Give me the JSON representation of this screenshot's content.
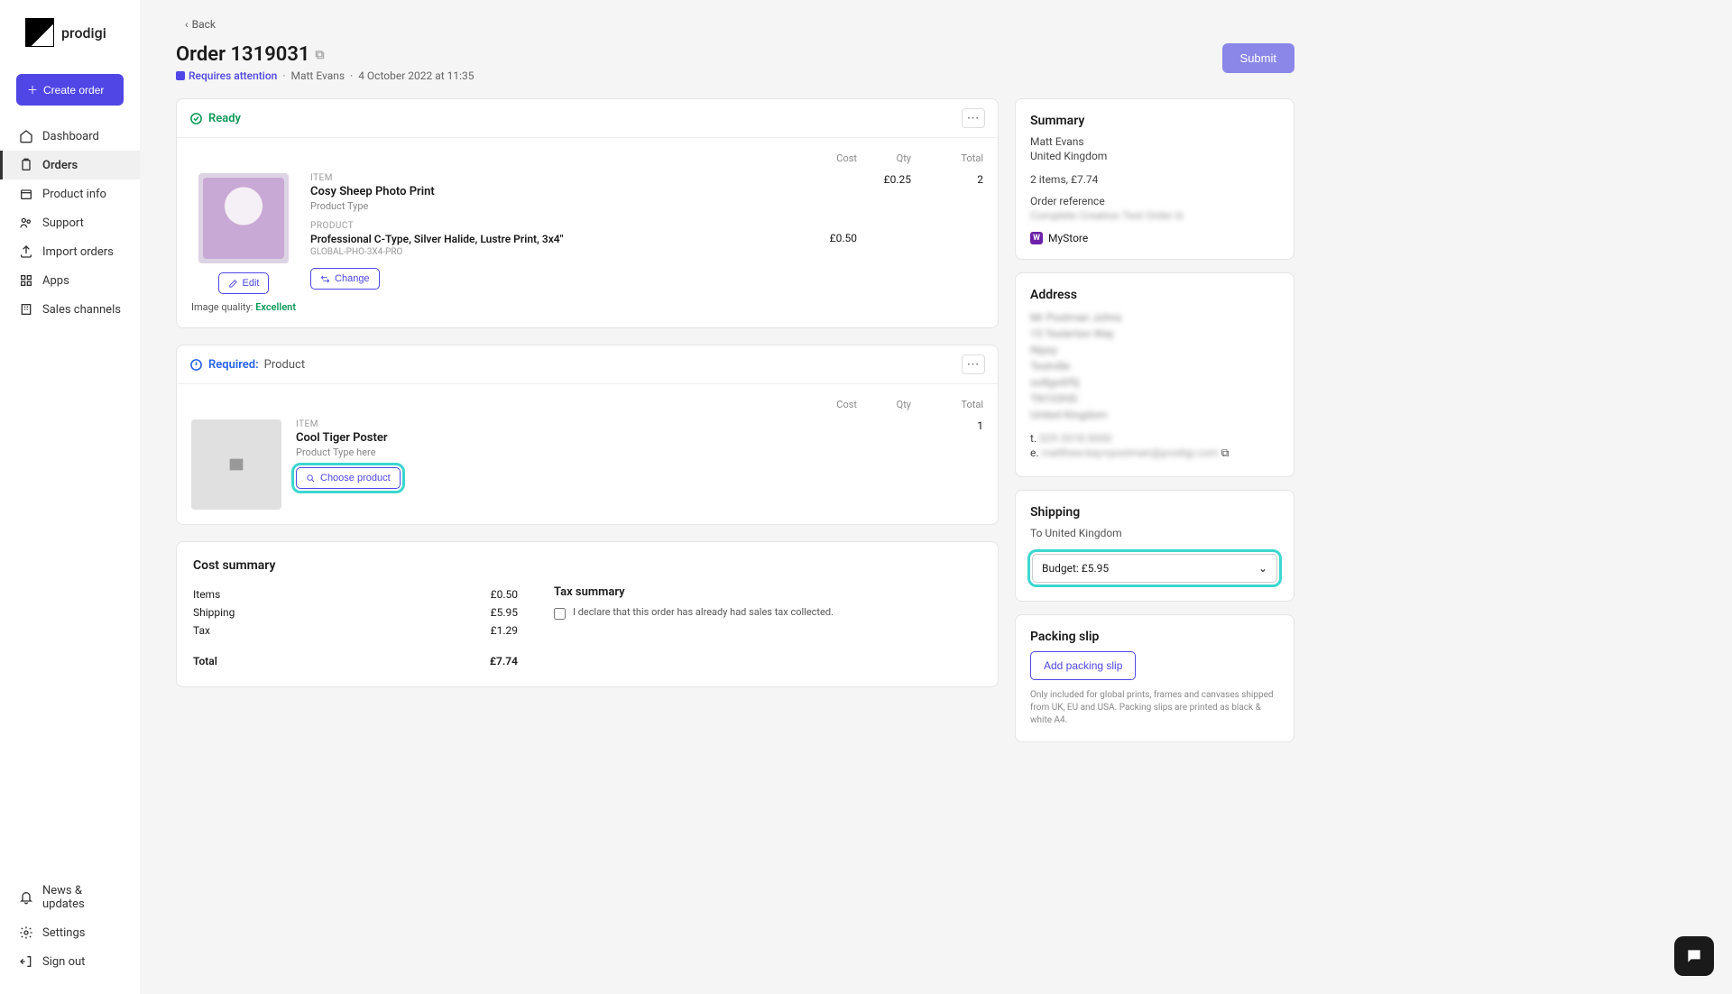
{
  "brand": {
    "name": "prodigi"
  },
  "sidebar": {
    "create_label": "Create order",
    "items": [
      {
        "label": "Dashboard"
      },
      {
        "label": "Orders"
      },
      {
        "label": "Product info"
      },
      {
        "label": "Support"
      },
      {
        "label": "Import orders"
      },
      {
        "label": "Apps"
      },
      {
        "label": "Sales channels"
      }
    ],
    "bottom": [
      {
        "label": "News & updates"
      },
      {
        "label": "Settings"
      },
      {
        "label": "Sign out"
      }
    ]
  },
  "back_label": "Back",
  "page_title": "Order 1319031",
  "status_requires": "Requires attention",
  "customer": "Matt Evans",
  "timestamp": "4 October 2022 at 11:35",
  "submit_label": "Submit",
  "line_cols": {
    "cost": "Cost",
    "qty": "Qty",
    "total": "Total"
  },
  "ready_label": "Ready",
  "item1": {
    "section_label": "ITEM",
    "name": "Cosy Sheep Photo Print",
    "type_label": "Product Type",
    "product_section_label": "PRODUCT",
    "product_line": "Professional C-Type, Silver Halide, Lustre Print, 3x4\"",
    "sku": "GLOBAL-PHO-3X4-PRO",
    "cost": "£0.25",
    "qty": "2",
    "total": "£0.50",
    "edit": "Edit",
    "change": "Change",
    "iq_label": "Image quality:",
    "iq_val": "Excellent"
  },
  "required_prefix": "Required:",
  "required_suffix": "Product",
  "item2": {
    "section_label": "ITEM",
    "name": "Cool Tiger Poster",
    "type_label": "Product Type here",
    "qty": "1",
    "choose": "Choose product"
  },
  "summary": {
    "title": "Summary",
    "name": "Matt Evans",
    "country": "United Kingdom",
    "items_line": "2 items, £7.74",
    "ref_label": "Order reference",
    "ref_value": "Complete Creation Test Order",
    "store": "MyStore"
  },
  "address": {
    "title": "Address",
    "phone_label": "t.",
    "email_label": "e."
  },
  "shipping": {
    "title": "Shipping",
    "to": "To United Kingdom",
    "selected": "Budget: £5.95"
  },
  "packing": {
    "title": "Packing slip",
    "add": "Add packing slip",
    "note": "Only included for global prints, frames and canvases shipped from UK, EU and USA. Packing slips are printed as black & white A4."
  },
  "cost": {
    "title": "Cost summary",
    "items_label": "Items",
    "items_val": "£0.50",
    "ship_label": "Shipping",
    "ship_val": "£5.95",
    "tax_label": "Tax",
    "tax_val": "£1.29",
    "total_label": "Total",
    "total_val": "£7.74",
    "tax_title": "Tax summary",
    "tax_declare": "I declare that this order has already had sales tax collected."
  }
}
